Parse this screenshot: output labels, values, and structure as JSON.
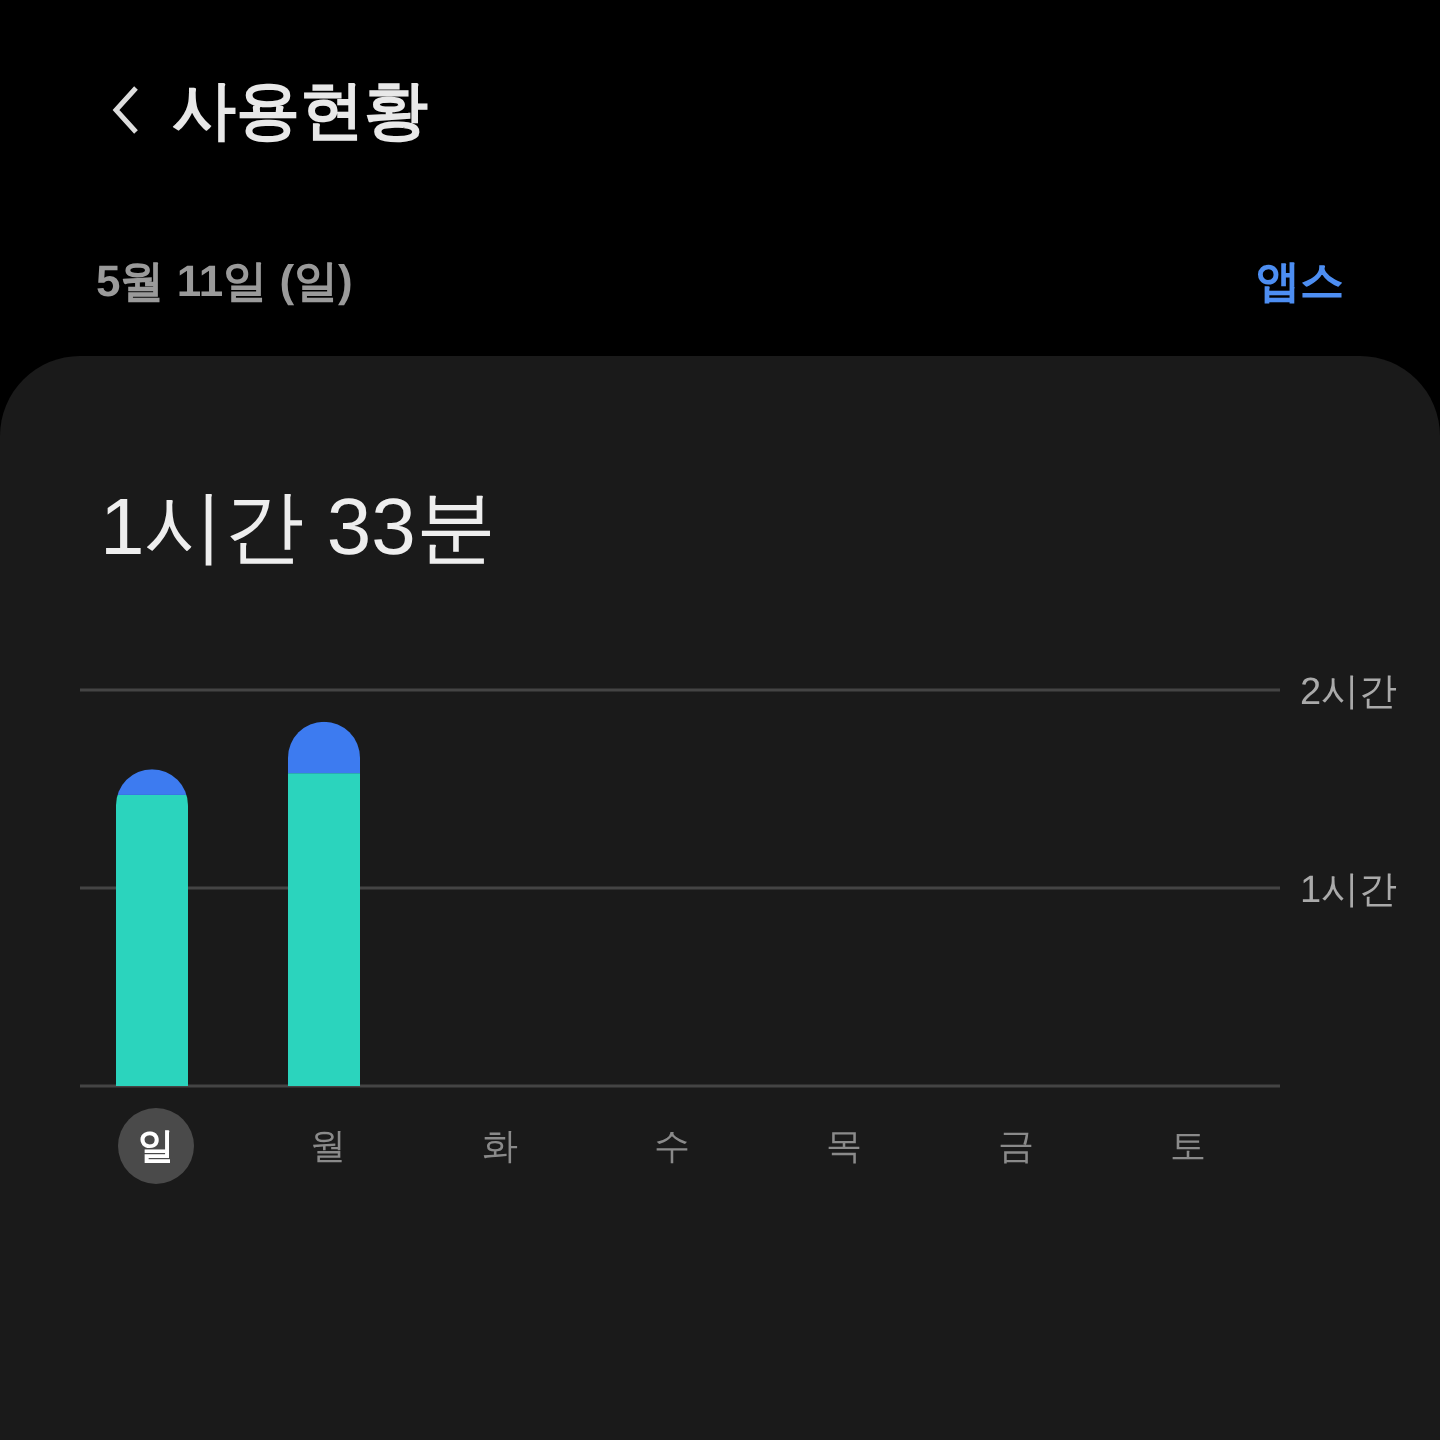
{
  "header": {
    "title": "사용현황"
  },
  "date_row": {
    "date": "5월 11일 (일)",
    "link": "앱스"
  },
  "card": {
    "total": "1시간 33분",
    "chart_data": {
      "type": "bar",
      "stacked": true,
      "categories": [
        "일",
        "월",
        "화",
        "수",
        "목",
        "금",
        "토"
      ],
      "series": [
        {
          "color": "#2bd4bd",
          "values": [
            1.47,
            1.58,
            0,
            0,
            0,
            0,
            0
          ]
        },
        {
          "color": "#3d7bf0",
          "values": [
            0.13,
            0.26,
            0,
            0,
            0,
            0,
            0
          ]
        }
      ],
      "ylim": [
        0,
        2
      ],
      "yticks": [
        {
          "value": 1,
          "label": "1시간"
        },
        {
          "value": 2,
          "label": "2시간"
        }
      ]
    },
    "days": [
      {
        "selected": true
      },
      {
        "selected": false
      },
      {
        "selected": false
      },
      {
        "selected": false
      },
      {
        "selected": false
      },
      {
        "selected": false
      },
      {
        "selected": false
      }
    ]
  }
}
